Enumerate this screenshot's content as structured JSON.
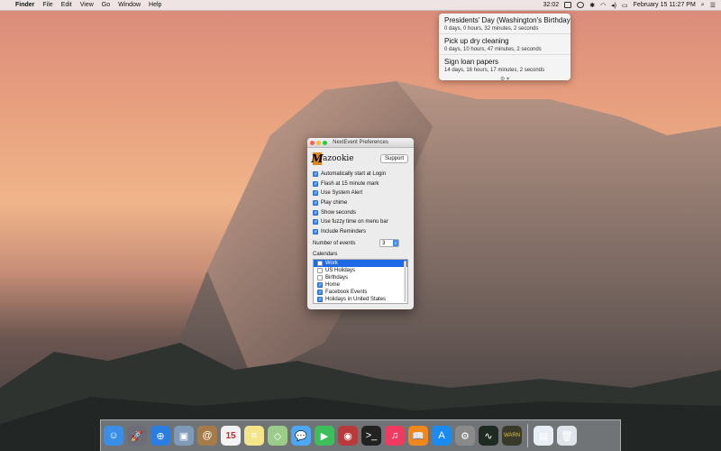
{
  "menubar": {
    "apple": "",
    "app_name": "Finder",
    "menus": [
      "File",
      "Edit",
      "View",
      "Go",
      "Window",
      "Help"
    ],
    "countdown": "32:02",
    "datetime": "February 15  11:27 PM"
  },
  "popup": {
    "events": [
      {
        "title": "Presidents' Day (Washington's Birthday)",
        "countdown": "0 days, 0 hours, 32 minutes, 2 seconds"
      },
      {
        "title": "Pick up dry cleaning",
        "countdown": "0 days, 10 hours, 47 minutes, 2 seconds"
      },
      {
        "title": "Sign loan papers",
        "countdown": "14 days, 16 hours, 17 minutes, 2 seconds"
      }
    ],
    "footer": "⚙ ▾"
  },
  "prefs": {
    "title": "NextEvent Preferences",
    "logo_letter": "M",
    "logo_text": "azookie",
    "support_label": "Support",
    "options": [
      {
        "label": "Automatically start at Login",
        "checked": true
      },
      {
        "label": "Flash at 15 minute mark",
        "checked": true
      },
      {
        "label": "Use System Alert",
        "checked": true
      },
      {
        "label": "Play chime",
        "checked": true
      },
      {
        "label": "Show seconds",
        "checked": true
      },
      {
        "label": "Use fuzzy time on menu bar",
        "checked": true
      },
      {
        "label": "Include Reminders",
        "checked": true
      }
    ],
    "events_label": "Number of events",
    "events_value": "3",
    "calendars_label": "Calendars",
    "calendars": [
      {
        "label": "Work",
        "checked": false,
        "selected": true
      },
      {
        "label": "US Holidays",
        "checked": false,
        "selected": false
      },
      {
        "label": "Birthdays",
        "checked": false,
        "selected": false
      },
      {
        "label": "Home",
        "checked": true,
        "selected": false
      },
      {
        "label": "Facebook Events",
        "checked": true,
        "selected": false
      },
      {
        "label": "Holidays in United States",
        "checked": true,
        "selected": false
      }
    ]
  },
  "dock": {
    "apps": [
      {
        "name": "finder-icon",
        "color": "#3b8ee8",
        "glyph": "☺"
      },
      {
        "name": "launchpad-icon",
        "color": "#6d6d78",
        "glyph": "🚀"
      },
      {
        "name": "safari-icon",
        "color": "#2a7de1",
        "glyph": "⊕"
      },
      {
        "name": "preview-icon",
        "color": "#7f99b8",
        "glyph": "▣"
      },
      {
        "name": "contacts-icon",
        "color": "#a57b48",
        "glyph": "@"
      },
      {
        "name": "calendar-icon",
        "color": "#f3f3f3",
        "glyph": "15"
      },
      {
        "name": "notes-icon",
        "color": "#f4e48a",
        "glyph": "≡"
      },
      {
        "name": "maps-icon",
        "color": "#9ccc8a",
        "glyph": "◇"
      },
      {
        "name": "messages-icon",
        "color": "#4ea7f4",
        "glyph": "💬"
      },
      {
        "name": "facetime-icon",
        "color": "#3cbf5a",
        "glyph": "▶"
      },
      {
        "name": "photobooth-icon",
        "color": "#b83a3a",
        "glyph": "◉"
      },
      {
        "name": "terminal-icon",
        "color": "#222222",
        "glyph": ">_"
      },
      {
        "name": "itunes-icon",
        "color": "#f03a5f",
        "glyph": "♫"
      },
      {
        "name": "ibooks-icon",
        "color": "#f2871c",
        "glyph": "📖"
      },
      {
        "name": "appstore-icon",
        "color": "#1b8bf0",
        "glyph": "A"
      },
      {
        "name": "system-preferences-icon",
        "color": "#8a8a8a",
        "glyph": "⚙"
      },
      {
        "name": "activity-monitor-icon",
        "color": "#1f2a22",
        "glyph": "∿"
      },
      {
        "name": "console-icon",
        "color": "#3a3a2a",
        "glyph": "WARN"
      }
    ],
    "trailing": [
      {
        "name": "document-icon",
        "color": "#e8eef5",
        "glyph": "▤"
      },
      {
        "name": "trash-icon",
        "color": "#dfe4ea",
        "glyph": "🗑"
      }
    ]
  }
}
